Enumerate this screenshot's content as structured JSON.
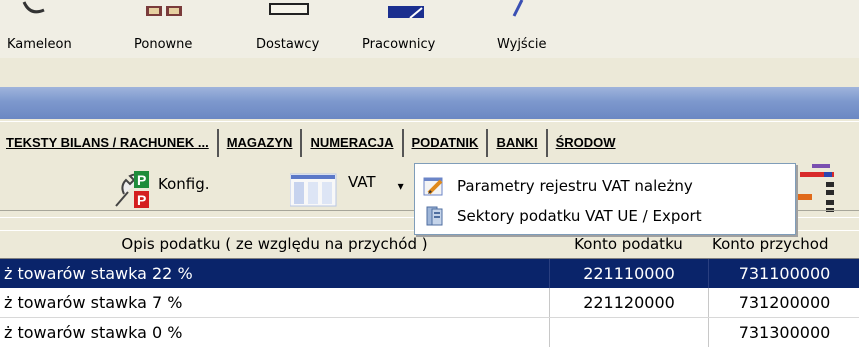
{
  "launcher": {
    "items": [
      {
        "label": "Kameleon",
        "icon": "chameleon-icon"
      },
      {
        "label": "Ponowne",
        "icon": "repeat-docs-icon"
      },
      {
        "label": "Dostawcy",
        "icon": "suppliers-icon"
      },
      {
        "label": "Pracownicy",
        "icon": "employees-icon"
      },
      {
        "label": "Wyjście",
        "icon": "exit-icon"
      }
    ]
  },
  "tabs": [
    {
      "label": "TEKSTY BILANS / RACHUNEK ..."
    },
    {
      "label": "MAGAZYN"
    },
    {
      "label": "NUMERACJA"
    },
    {
      "label": "PODATNIK"
    },
    {
      "label": "BANKI"
    },
    {
      "label": "ŚRODOW"
    }
  ],
  "toolbar": {
    "konfig_label": "Konfig.",
    "vat_label": "VAT",
    "vat_arrow": "▾"
  },
  "menu": {
    "items": [
      {
        "label": "Parametry rejestru VAT należny",
        "icon": "pencil-icon"
      },
      {
        "label": "Sektory podatku VAT UE / Export",
        "icon": "server-icon"
      }
    ]
  },
  "table": {
    "columns": [
      "Opis podatku ( ze względu na przychód )",
      "Konto podatku",
      "Konto przychod"
    ],
    "rows": [
      {
        "opis": "ż towarów stawka 22 %",
        "konto_podatku": "221110000",
        "konto_przychodu": "731100000",
        "selected": true
      },
      {
        "opis": "ż towarów stawka 7 %",
        "konto_podatku": "221120000",
        "konto_przychodu": "731200000",
        "selected": false
      },
      {
        "opis": "ż towarów stawka 0 %",
        "konto_podatku": "",
        "konto_przychodu": "731300000",
        "selected": false
      }
    ]
  },
  "colors": {
    "selection": "#0a246a",
    "titlebar": "#7d98cd",
    "face": "#ece9d8"
  }
}
